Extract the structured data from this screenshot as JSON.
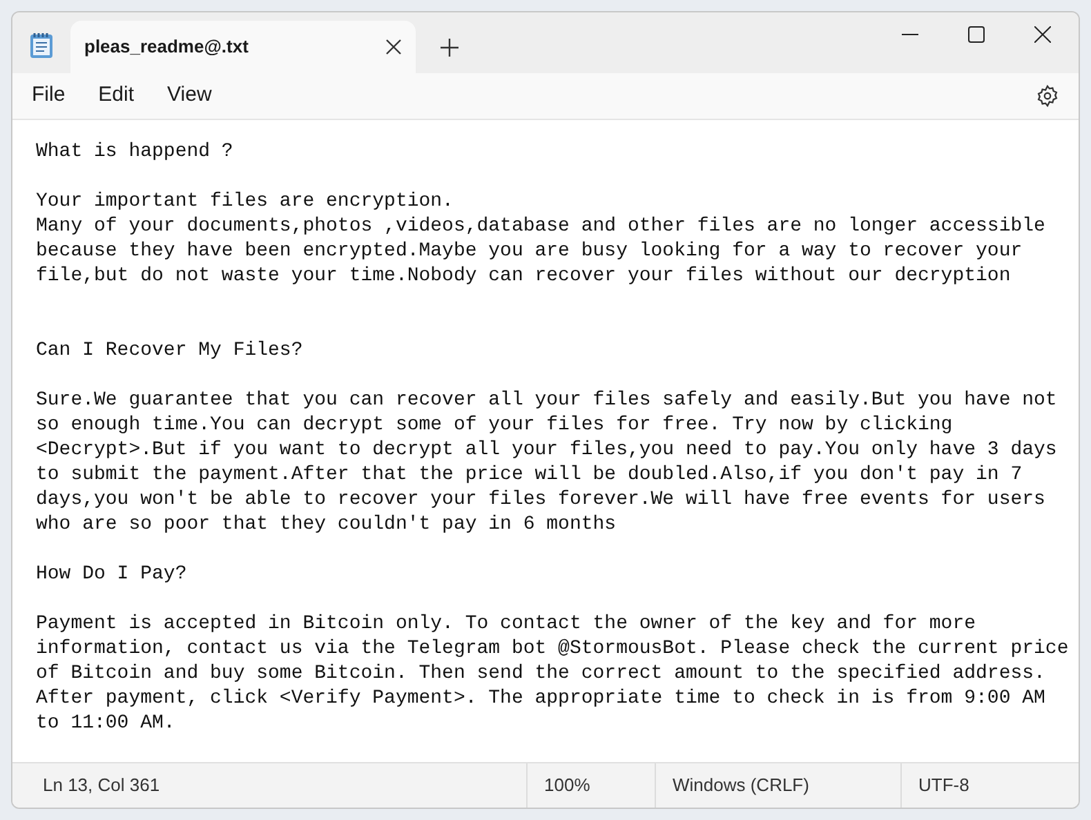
{
  "tab": {
    "title": "pleas_readme@.txt"
  },
  "menu": [
    "File",
    "Edit",
    "View"
  ],
  "document": {
    "text": "What is happend ?\n\nYour important files are encryption.\nMany of your documents,photos ,videos,database and other files are no longer accessible\nbecause they have been encrypted.Maybe you are busy looking for a way to recover your\nfile,but do not waste your time.Nobody can recover your files without our decryption\n\n\nCan I Recover My Files?\n\nSure.We guarantee that you can recover all your files safely and easily.But you have not\nso enough time.You can decrypt some of your files for free. Try now by clicking\n<Decrypt>.But if you want to decrypt all your files,you need to pay.You only have 3 days\nto submit the payment.After that the price will be doubled.Also,if you don't pay in 7\ndays,you won't be able to recover your files forever.We will have free events for users\nwho are so poor that they couldn't pay in 6 months\n\nHow Do I Pay?\n\nPayment is accepted in Bitcoin only. To contact the owner of the key and for more\ninformation, contact us via the Telegram bot @StormousBot. Please check the current price\nof Bitcoin and buy some Bitcoin. Then send the correct amount to the specified address.\nAfter payment, click <Verify Payment>. The appropriate time to check in is from 9:00 AM\nto 11:00 AM."
  },
  "status_bar": [
    "Ln 13, Col 361",
    "100%",
    "Windows (CRLF)",
    "UTF-8"
  ]
}
